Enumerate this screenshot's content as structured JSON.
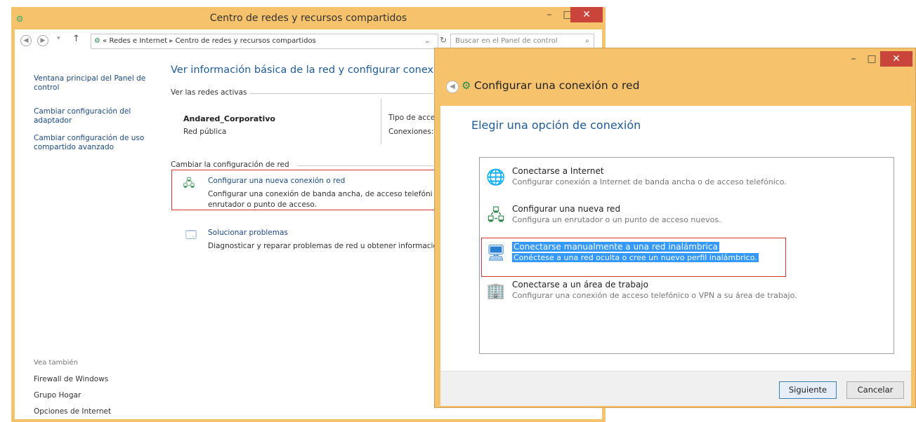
{
  "back_window": {
    "title": "Centro de redes y recursos compartidos",
    "address": {
      "sep": "«",
      "crumb1": "Redes e Internet",
      "arrow": "▸",
      "crumb2": "Centro de redes y recursos compartidos"
    },
    "search_placeholder": "Buscar en el Panel de control",
    "sidebar": {
      "home_link": [
        "Ventana principal del Panel de",
        "control"
      ],
      "adapter_link": [
        "Cambiar configuración del",
        "adaptador"
      ],
      "sharing_link": [
        "Cambiar configuración de uso",
        "compartido avanzado"
      ],
      "see_also": "Vea también",
      "see_also_links": [
        "Firewall de Windows",
        "Grupo Hogar",
        "Opciones de Internet"
      ]
    },
    "main": {
      "title": "Ver información básica de la red y configurar conexion",
      "active_networks_label": "Ver las redes activas",
      "network_name": "Andared_Corporativo",
      "network_type": "Red pública",
      "access_type_label": "Tipo de acce",
      "connections_label": "Conexiones:",
      "change_settings_label": "Cambiar la configuración de red",
      "setup_link": "Configurar una nueva conexión o red",
      "setup_desc": [
        "Configurar una conexión de banda ancha, de acceso telefóni",
        "enrutador o punto de acceso."
      ],
      "troubleshoot_link": "Solucionar problemas",
      "troubleshoot_desc": "Diagnosticar y reparar problemas de red u obtener informació"
    }
  },
  "dialog": {
    "title": "Configurar una conexión o red",
    "heading": "Elegir una opción de conexión",
    "options": [
      {
        "title": "Conectarse a Internet",
        "desc": "Configurar conexión a Internet de banda ancha o de acceso telefónico.",
        "icon": "globe-icon"
      },
      {
        "title": "Configurar una nueva red",
        "desc": "Configura un enrutador o un punto de acceso nuevos.",
        "icon": "router-icon"
      },
      {
        "title": "Conectarse manualmente a una red inalámbrica",
        "desc": "Conéctese a una red oculta o cree un nuevo perfil inalámbrico.",
        "icon": "wireless-icon",
        "selected": true
      },
      {
        "title": "Conectarse a un área de trabajo",
        "desc": "Configurar una conexión de acceso telefónico o VPN a su área de trabajo.",
        "icon": "workplace-icon"
      }
    ],
    "next_label": "Siguiente",
    "cancel_label": "Cancelar"
  }
}
